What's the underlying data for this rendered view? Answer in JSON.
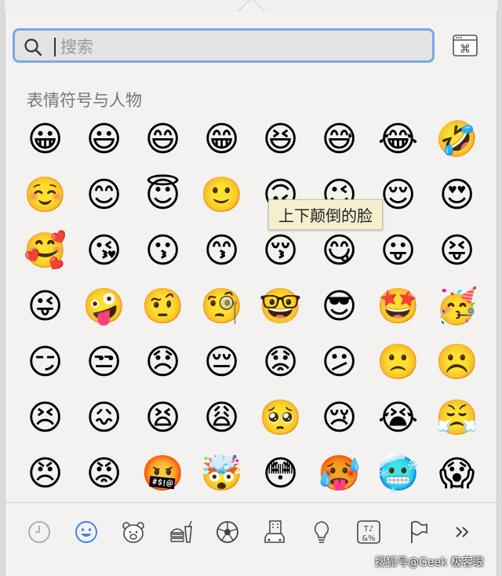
{
  "search": {
    "placeholder": "搜索",
    "value": ""
  },
  "category_title": "表情符号与人物",
  "tooltip": "上下颠倒的脸",
  "emojis": [
    "😀",
    "😃",
    "😄",
    "😁",
    "😆",
    "😅",
    "😂",
    "🤣",
    "☺️",
    "😊",
    "😇",
    "🙂",
    "🙃",
    "😉",
    "😌",
    "😍",
    "🥰",
    "😘",
    "😗",
    "😙",
    "😚",
    "😋",
    "😛",
    "😝",
    "😜",
    "🤪",
    "🤨",
    "🧐",
    "🤓",
    "😎",
    "🤩",
    "🥳",
    "😏",
    "😒",
    "😞",
    "😔",
    "😟",
    "😕",
    "🙁",
    "☹️",
    "😣",
    "😖",
    "😫",
    "😩",
    "🥺",
    "😢",
    "😭",
    "😤",
    "😠",
    "😡",
    "🤬",
    "🤯",
    "😳",
    "🥵",
    "🥶",
    "😱"
  ],
  "tabs": [
    {
      "icon": "clock-icon",
      "active": false
    },
    {
      "icon": "smiley-icon",
      "active": true
    },
    {
      "icon": "bear-icon",
      "active": false
    },
    {
      "icon": "food-icon",
      "active": false
    },
    {
      "icon": "soccer-ball-icon",
      "active": false
    },
    {
      "icon": "car-building-icon",
      "active": false
    },
    {
      "icon": "lightbulb-icon",
      "active": false
    },
    {
      "icon": "symbols-icon",
      "active": false
    },
    {
      "icon": "flag-icon",
      "active": false
    },
    {
      "icon": "more-chevron-icon",
      "active": false
    }
  ],
  "colors": {
    "accent": "#3b86e8",
    "focus_ring": "#7aa7e6",
    "tooltip_bg": "#f5efd0"
  },
  "watermark": "搜狐号@Geek 极客眼"
}
